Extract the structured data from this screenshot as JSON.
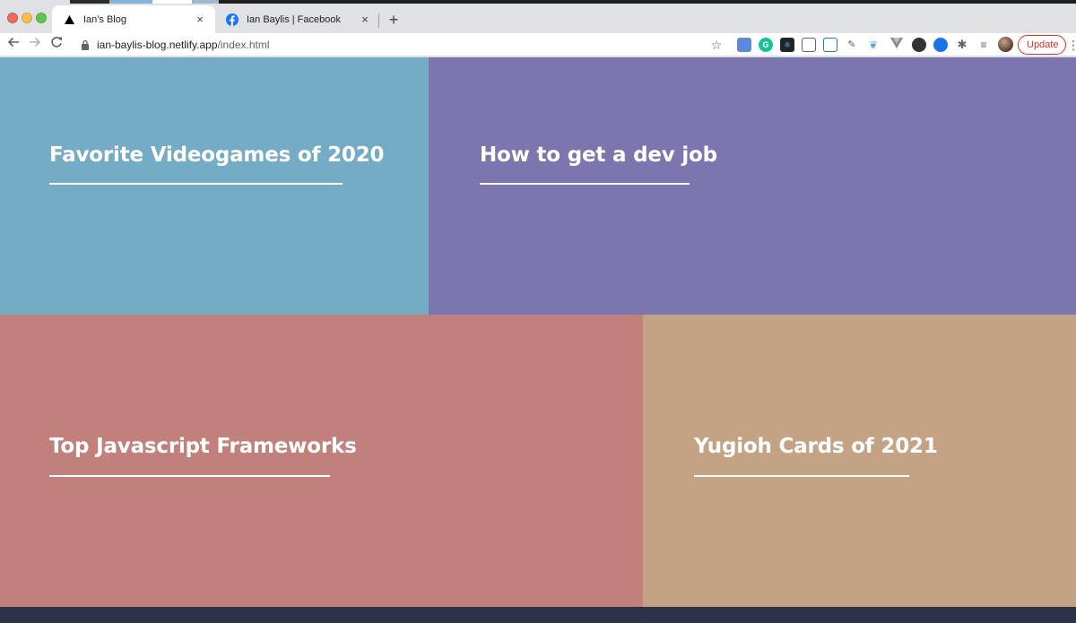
{
  "browser": {
    "tabs": [
      {
        "title": "Ian's Blog",
        "active": true,
        "favicon": "triangle-icon"
      },
      {
        "title": "Ian Baylis | Facebook",
        "active": false,
        "favicon": "facebook-icon"
      }
    ],
    "new_tab_label": "+",
    "close_label": "×",
    "url_host": "ian-baylis-blog.netlify.app",
    "url_path": "/index.html",
    "update_label": "Update",
    "menu_label": "⋮"
  },
  "posts": [
    {
      "title": "Favorite Videogames of 2020",
      "color": "#74abc5"
    },
    {
      "title": "How to get a dev job",
      "color": "#7c76ae"
    },
    {
      "title": "Top Javascript Frameworks",
      "color": "#c2807c"
    },
    {
      "title": "Yugioh Cards of 2021",
      "color": "#c3a383"
    }
  ],
  "footer": {
    "color": "#2c3247"
  }
}
